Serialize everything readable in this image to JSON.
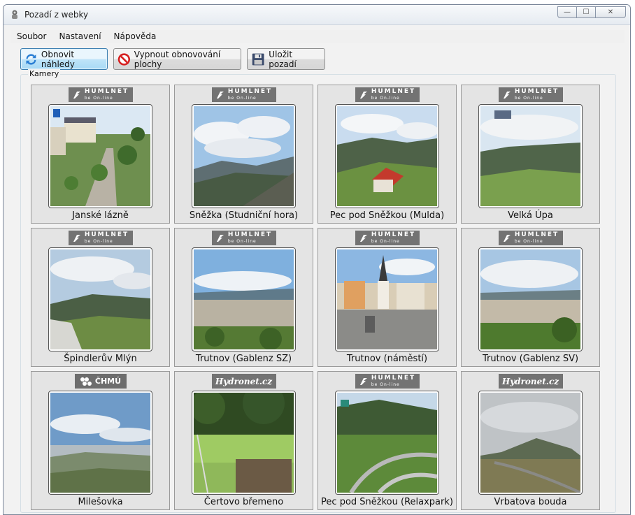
{
  "window": {
    "title": "Pozadí z webky"
  },
  "menu": [
    "Soubor",
    "Nastavení",
    "Nápověda"
  ],
  "toolbar": {
    "refresh": "Obnovit náhledy",
    "disable": "Vypnout obnovování plochy",
    "save": "Uložit pozadí"
  },
  "group": {
    "label": "Kamery"
  },
  "logos": {
    "humlnet_main": "HUMLNET",
    "humlnet_sub": "be On-line",
    "hydronet": "Hydronet.cz",
    "chmu": "ČHMÚ"
  },
  "cameras": [
    {
      "name": "Janské lázně",
      "logo": "humlnet"
    },
    {
      "name": "Sněžka (Studniční hora)",
      "logo": "humlnet"
    },
    {
      "name": "Pec pod Sněžkou (Mulda)",
      "logo": "humlnet"
    },
    {
      "name": "Velká Úpa",
      "logo": "humlnet"
    },
    {
      "name": "Špindlerův Mlýn",
      "logo": "humlnet"
    },
    {
      "name": "Trutnov (Gablenz SZ)",
      "logo": "humlnet"
    },
    {
      "name": "Trutnov (náměstí)",
      "logo": "humlnet"
    },
    {
      "name": "Trutnov (Gablenz SV)",
      "logo": "humlnet"
    },
    {
      "name": "Milešovka",
      "logo": "chmu"
    },
    {
      "name": "Čertovo břemeno",
      "logo": "hydronet"
    },
    {
      "name": "Pec pod Sněžkou (Relaxpark)",
      "logo": "humlnet"
    },
    {
      "name": "Vrbatova bouda",
      "logo": "hydronet"
    }
  ]
}
